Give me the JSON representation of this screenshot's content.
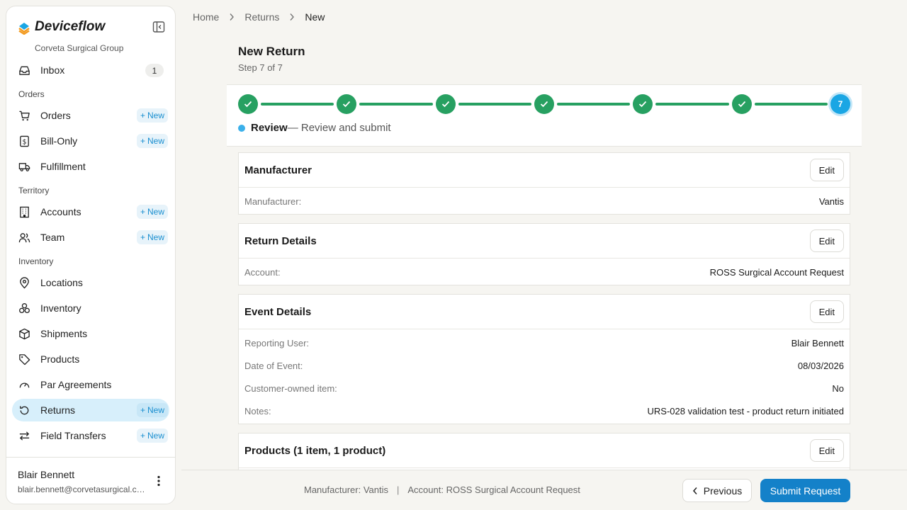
{
  "brand": {
    "name": "Deviceflow",
    "org": "Corveta Surgical Group"
  },
  "nav": {
    "inbox": {
      "label": "Inbox",
      "badge": "1"
    },
    "orders_section": "Orders",
    "orders": {
      "label": "Orders",
      "new": "New"
    },
    "bill_only": {
      "label": "Bill-Only",
      "new": "New"
    },
    "fulfillment": {
      "label": "Fulfillment"
    },
    "territory_section": "Territory",
    "accounts": {
      "label": "Accounts",
      "new": "New"
    },
    "team": {
      "label": "Team",
      "new": "New"
    },
    "inventory_section": "Inventory",
    "locations": {
      "label": "Locations"
    },
    "inventory": {
      "label": "Inventory"
    },
    "shipments": {
      "label": "Shipments"
    },
    "products": {
      "label": "Products"
    },
    "par_agreements": {
      "label": "Par Agreements"
    },
    "returns": {
      "label": "Returns",
      "new": "New"
    },
    "field_transfers": {
      "label": "Field Transfers",
      "new": "New"
    }
  },
  "user": {
    "name": "Blair Bennett",
    "email": "blair.bennett@corvetasurgical.com"
  },
  "breadcrumb": [
    "Home",
    "Returns",
    "New"
  ],
  "page": {
    "title": "New Return",
    "step": "Step 7 of 7"
  },
  "stepper": {
    "current_number": "7",
    "current_name": "Review",
    "current_desc": "— Review and submit",
    "completed_steps": 6,
    "total_steps": 7
  },
  "sections": {
    "manufacturer": {
      "title": "Manufacturer",
      "edit": "Edit",
      "rows": [
        {
          "label": "Manufacturer:",
          "value": "Vantis"
        }
      ]
    },
    "return_details": {
      "title": "Return Details",
      "edit": "Edit",
      "rows": [
        {
          "label": "Account:",
          "value": "ROSS Surgical Account Request"
        }
      ]
    },
    "event_details": {
      "title": "Event Details",
      "edit": "Edit",
      "rows": [
        {
          "label": "Reporting User:",
          "value": "Blair Bennett"
        },
        {
          "label": "Date of Event:",
          "value": "08/03/2026"
        },
        {
          "label": "Customer-owned item:",
          "value": "No"
        },
        {
          "label": "Notes:",
          "value": "URS-028 validation test - product return initiated"
        }
      ]
    },
    "products": {
      "title": "Products (1 item, 1 product)",
      "edit": "Edit"
    }
  },
  "footer": {
    "manufacturer_summary": "Manufacturer: Vantis",
    "separator": "|",
    "account_summary": "Account: ROSS Surgical Account Request",
    "previous": "Previous",
    "submit": "Submit Request"
  },
  "colors": {
    "accent": "#1481c9",
    "success": "#27a061",
    "active_nav": "#d7effb"
  }
}
